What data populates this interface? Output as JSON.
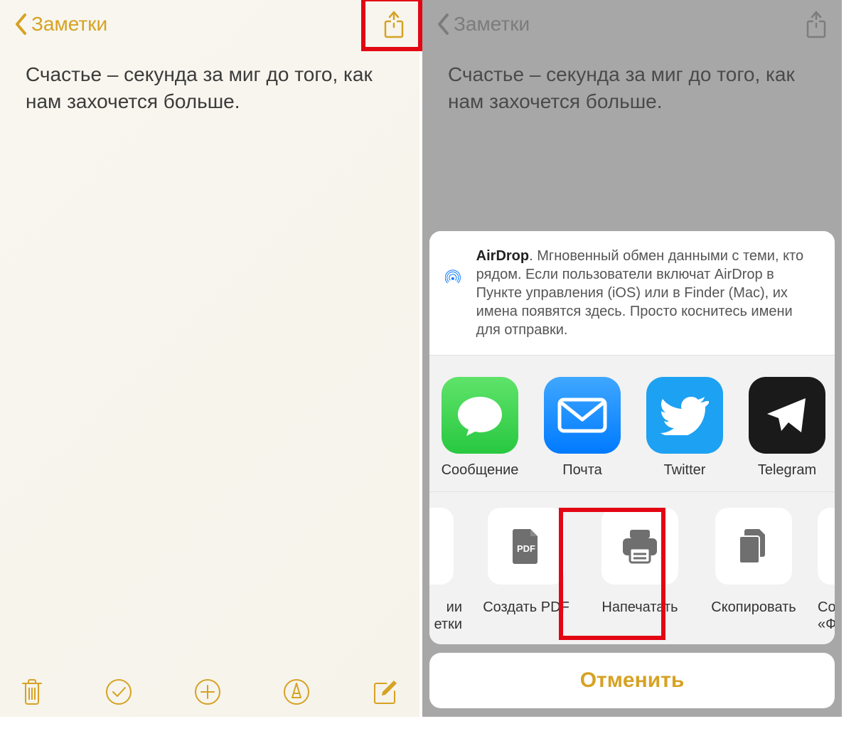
{
  "left": {
    "back_label": "Заметки",
    "note_text": "Счастье – секунда за миг до того, как нам захочется больше."
  },
  "right": {
    "back_label": "Заметки",
    "note_text": "Счастье – секунда за миг до того, как нам захочется больше.",
    "airdrop": {
      "title": "AirDrop",
      "desc": ". Мгновенный обмен данными с теми, кто рядом. Если пользователи включат AirDrop в Пункте управления (iOS) или в Finder (Mac), их имена появятся здесь. Просто коснитесь имени для отправки."
    },
    "apps": [
      {
        "label": "Сообщение"
      },
      {
        "label": "Почта"
      },
      {
        "label": "Twitter"
      },
      {
        "label": "Telegram"
      }
    ],
    "actions_partial_left": {
      "label_line1": "ии",
      "label_line2": "етки"
    },
    "actions": [
      {
        "label": "Создать PDF",
        "kind": "pdf"
      },
      {
        "label": "Напечатать",
        "kind": "print"
      },
      {
        "label": "Скопировать",
        "kind": "copy"
      }
    ],
    "actions_partial_right": {
      "label_line1": "Сохранить",
      "label_line2": "«Файлы»",
      "kind": "folder"
    },
    "cancel": "Отменить"
  },
  "colors": {
    "accent": "#d6a224",
    "highlight": "#e30613"
  }
}
